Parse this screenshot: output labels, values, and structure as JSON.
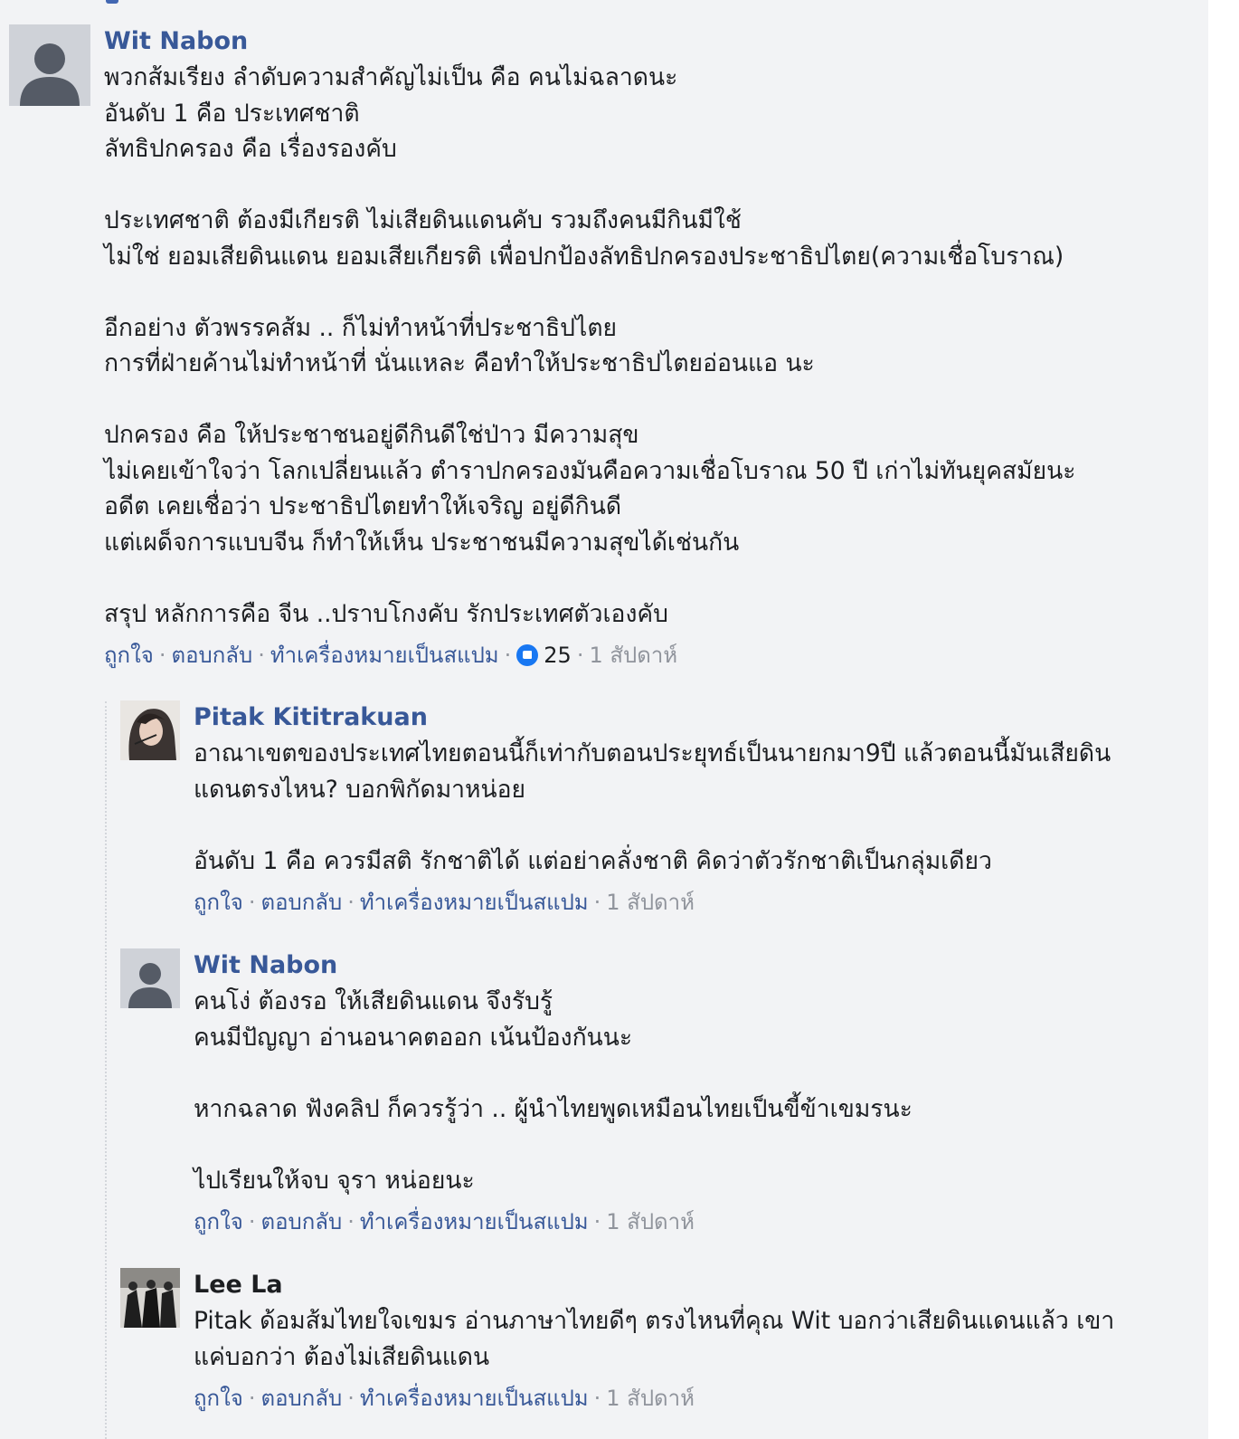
{
  "comments": [
    {
      "author": "Wit Nabon",
      "avatar_icon": "default-avatar-icon",
      "text": "พวกส้มเรียง ลำดับความสำคัญไม่เป็น คือ คนไม่ฉลาดนะ\nอันดับ 1 คือ ประเทศชาติ\nลัทธิปกครอง คือ เรื่องรองคับ\n\nประเทศชาติ ต้องมีเกียรติ ไม่เสียดินแดนคับ รวมถึงคนมีกินมีใช้\nไม่ใช่ ยอมเสียดินแดน ยอมเสียเกียรติ เพื่อปกป้องลัทธิปกครองประชาธิปไตย(ความเชื่อโบราณ)\n\nอีกอย่าง ตัวพรรคส้ม .. ก็ไม่ทำหน้าที่ประชาธิปไตย\nการที่ฝ่ายค้านไม่ทำหน้าที่ นั่นแหละ คือทำให้ประชาธิปไตยอ่อนแอ นะ\n\nปกครอง คือ ให้ประชาชนอยู่ดีกินดีใช่ป่าว มีความสุข\nไม่เคยเข้าใจว่า โลกเปลี่ยนแล้ว ตำราปกครองมันคือความเชื่อโบราณ 50 ปี เก่าไม่ทันยุคสมัยนะ\nอดีต เคยเชื่อว่า ประชาธิปไตยทำให้เจริญ อยู่ดีกินดี\nแต่เผด็จการแบบจีน ก็ทำให้เห็น ประชาชนมีความสุขได้เช่นกัน\n\nสรุป หลักการคือ จีน ..ปราบโกงคับ รักประเทศตัวเองคับ",
      "like_label": "ถูกใจ",
      "reply_label": "ตอบกลับ",
      "spam_label": "ทำเครื่องหมายเป็นสแปม",
      "reaction_count": "25",
      "reaction_icon": "like-reaction-icon",
      "time": "1 สัปดาห์"
    },
    {
      "author": "Pitak Kititrakuan",
      "avatar_icon": "user-photo-avatar",
      "text": "อาณาเขตของประเทศไทยตอนนี้ก็เท่ากับตอนประยุทธ์เป็นนายกมา9ปี แล้วตอนนี้มันเสียดิน\nแดนตรงไหน? บอกพิกัดมาหน่อย\n\nอันดับ 1 คือ ควรมีสติ รักชาติได้ แต่อย่าคลั่งชาติ คิดว่าตัวรักชาติเป็นกลุ่มเดียว",
      "like_label": "ถูกใจ",
      "reply_label": "ตอบกลับ",
      "spam_label": "ทำเครื่องหมายเป็นสแปม",
      "time": "1 สัปดาห์"
    },
    {
      "author": "Wit Nabon",
      "avatar_icon": "default-avatar-icon",
      "text": "คนโง่ ต้องรอ ให้เสียดินแดน จึงรับรู้\nคนมีปัญญา อ่านอนาคตออก เน้นป้องกันนะ\n\nหากฉลาด ฟังคลิป ก็ควรรู้ว่า .. ผู้นำไทยพูดเหมือนไทยเป็นขี้ข้าเขมรนะ\n\nไปเรียนให้จบ จุรา หน่อยนะ",
      "like_label": "ถูกใจ",
      "reply_label": "ตอบกลับ",
      "spam_label": "ทำเครื่องหมายเป็นสแปม",
      "time": "1 สัปดาห์"
    },
    {
      "author": "Lee La",
      "avatar_icon": "user-photo-avatar",
      "text": "Pitak ด้อมส้มไทยใจเขมร อ่านภาษาไทยดีๆ ตรงไหนที่คุณ Wit บอกว่าเสียดินแดนแล้ว เขา\nแค่บอกว่า ต้องไม่เสียดินแดน",
      "like_label": "ถูกใจ",
      "reply_label": "ตอบกลับ",
      "spam_label": "ทำเครื่องหมายเป็นสแปม",
      "time": "1 สัปดาห์"
    }
  ],
  "colors": {
    "link": "#385898",
    "text": "#1c1e21",
    "meta": "#90949c",
    "panel": "#f2f3f5",
    "reaction": "#1877f2"
  }
}
